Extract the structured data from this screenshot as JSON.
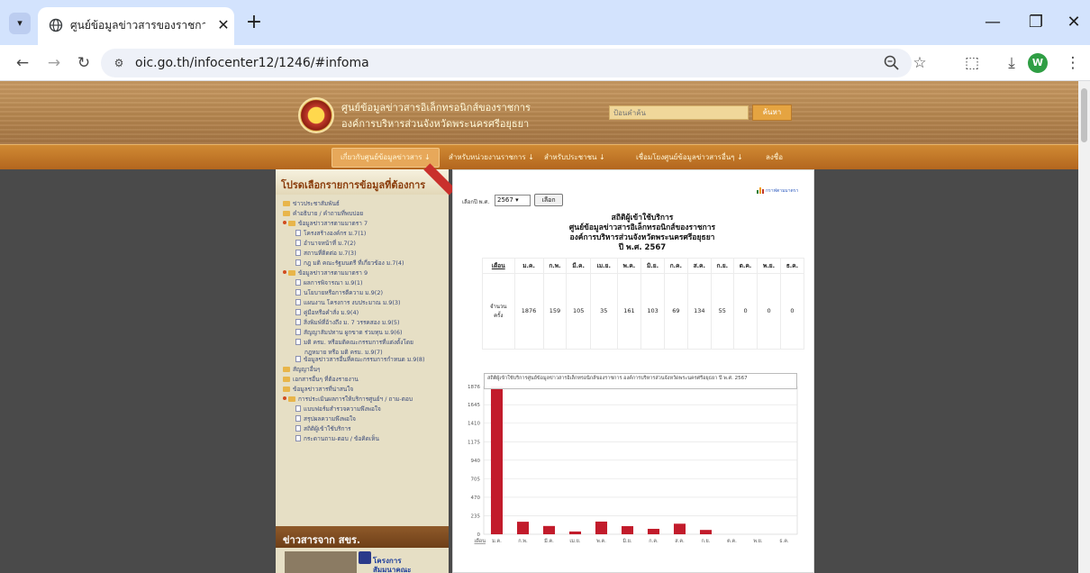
{
  "browser": {
    "tab_title": "ศูนย์ข้อมูลข่าวสารของราชการ » องค์",
    "url": "oic.go.th/infocenter12/1246/#infoma",
    "profile_initial": "W"
  },
  "site": {
    "title_line1": "ศูนย์ข้อมูลข่าวสารอิเล็กทรอนิกส์ของราชการ",
    "title_line2": "องค์การบริหารส่วนจังหวัดพระนครศรีอยุธยา",
    "search_placeholder": "ป้อนคำค้น",
    "search_button": "ค้นหา"
  },
  "nav": [
    "เกี่ยวกับศูนย์ข้อมูลข่าวสาร ↓",
    "สำหรับหน่วยงานราชการ ↓",
    "สำหรับประชาชน ↓",
    "เชื่อมโยงศูนย์ข้อมูลข่าวสารอื่นๆ ↓",
    "ลงชื่อ"
  ],
  "sidebar": {
    "title": "โปรดเลือกรายการข้อมูลที่ต้องการ",
    "items": [
      {
        "label": "ข่าวประชาสัมพันธ์",
        "level": 1,
        "icon": "folder"
      },
      {
        "label": "คำอธิบาย / คำถามที่พบบ่อย",
        "level": 1,
        "icon": "folder"
      },
      {
        "label": "ข้อมูลข่าวสารตามมาตรา 7",
        "level": 1,
        "icon": "folder-open"
      },
      {
        "label": "โครงสร้างองค์กร ม.7(1)",
        "level": 2,
        "icon": "doc"
      },
      {
        "label": "อำนาจหน้าที่ ม.7(2)",
        "level": 2,
        "icon": "doc"
      },
      {
        "label": "สถานที่ติดต่อ ม.7(3)",
        "level": 2,
        "icon": "doc"
      },
      {
        "label": "กฎ มติ คณะรัฐมนตรี ที่เกี่ยวข้อง ม.7(4)",
        "level": 2,
        "icon": "doc"
      },
      {
        "label": "ข้อมูลข่าวสารตามมาตรา 9",
        "level": 1,
        "icon": "folder-open"
      },
      {
        "label": "ผลการพิจารณา ม.9(1)",
        "level": 2,
        "icon": "doc"
      },
      {
        "label": "นโยบายหรือการตีความ ม.9(2)",
        "level": 2,
        "icon": "doc"
      },
      {
        "label": "แผนงาน โครงการ งบประมาณ ม.9(3)",
        "level": 2,
        "icon": "doc"
      },
      {
        "label": "คู่มือหรือคำสั่ง ม.9(4)",
        "level": 2,
        "icon": "doc"
      },
      {
        "label": "สิ่งพิมพ์ที่อ้างถึง ม. 7 วรรคสอง ม.9(5)",
        "level": 2,
        "icon": "doc"
      },
      {
        "label": "สัญญาสัมปทาน ผูกขาด ร่วมทุน ม.9(6)",
        "level": 2,
        "icon": "doc"
      },
      {
        "label": "มติ ครม. หรือมติคณะกรรมการที่แต่งตั้งโดย",
        "level": 2,
        "icon": "doc"
      },
      {
        "label": "กฎหมาย หรือ มติ ครม. ม.9(7)",
        "level": 3,
        "icon": "none"
      },
      {
        "label": "ข้อมูลข่าวสารอื่นที่คณะกรรมการกำหนด ม.9(8)",
        "level": 2,
        "icon": "doc"
      },
      {
        "label": "สัญญาอื่นๆ",
        "level": 1,
        "icon": "folder"
      },
      {
        "label": "เอกสารอื่นๆ ที่ต้องรายงาน",
        "level": 1,
        "icon": "folder"
      },
      {
        "label": "ข้อมูลข่าวสารที่น่าสนใจ",
        "level": 1,
        "icon": "folder"
      },
      {
        "label": "การประเมินผลการให้บริการศูนย์ฯ / ถาม-ตอบ",
        "level": 1,
        "icon": "folder-open"
      },
      {
        "label": "แบบฟอร์มสำรวจความพึงพอใจ",
        "level": 2,
        "icon": "doc"
      },
      {
        "label": "สรุปผลความพึงพอใจ",
        "level": 2,
        "icon": "doc"
      },
      {
        "label": "สถิติผู้เข้าใช้บริการ",
        "level": 2,
        "icon": "doc"
      },
      {
        "label": "กระดานถาม-ตอบ / ข้อคิดเห็น",
        "level": 2,
        "icon": "doc"
      }
    ],
    "news_title": "ข่าวสารจาก สขร.",
    "news_link_1": "โครงการ",
    "news_link_2": "สัมมนาคณะ"
  },
  "content": {
    "year_label": "เลือกปี พ.ศ.",
    "year_value": "2567",
    "choose_button": "เลือก",
    "graph_link": "กราฟตามมาตรา",
    "title_lines": [
      "สถิติผู้เข้าใช้บริการ",
      "ศูนย์ข้อมูลข่าวสารอิเล็กทรอนิกส์ของราชการ",
      "องค์การบริหารส่วนจังหวัดพระนครศรีอยุธยา",
      "ปี พ.ศ. 2567"
    ],
    "table": {
      "month_header": "เดือน",
      "months": [
        "ม.ค.",
        "ก.พ.",
        "มี.ค.",
        "เม.ย.",
        "พ.ค.",
        "มิ.ย.",
        "ก.ค.",
        "ส.ค.",
        "ก.ย.",
        "ต.ค.",
        "พ.ย.",
        "ธ.ค."
      ],
      "row_label_1": "จำนวน",
      "row_label_2": "ครั้ง",
      "values": [
        "1876",
        "159",
        "105",
        "35",
        "161",
        "103",
        "69",
        "134",
        "55",
        "0",
        "0",
        "0"
      ]
    },
    "tooltip": "สถิติผู้เข้าใช้บริการศูนย์ข้อมูลข่าวสารอิเล็กทรอนิกส์ของราชการ องค์การบริหารส่วนจังหวัดพระนครศรีอยุธยา ปี พ.ศ. 2567"
  },
  "chart_data": {
    "type": "bar",
    "title": "สถิติผู้เข้าใช้บริการศูนย์ข้อมูลข่าวสารอิเล็กทรอนิกส์ของราชการ องค์การบริหารส่วนจังหวัดพระนครศรีอยุธยา ปี พ.ศ. 2567",
    "xlabel": "เดือน",
    "categories": [
      "ม.ค.",
      "ก.พ.",
      "มี.ค.",
      "เม.ย.",
      "พ.ค.",
      "มิ.ย.",
      "ก.ค.",
      "ส.ค.",
      "ก.ย.",
      "ต.ค.",
      "พ.ย.",
      "ธ.ค."
    ],
    "values": [
      1876,
      159,
      105,
      35,
      161,
      103,
      69,
      134,
      55,
      0,
      0,
      0
    ],
    "yticks": [
      0,
      235,
      470,
      705,
      940,
      1175,
      1410,
      1645,
      1876
    ],
    "ylim": [
      0,
      1876
    ],
    "bar_color": "#c21b2b",
    "grid": true
  }
}
